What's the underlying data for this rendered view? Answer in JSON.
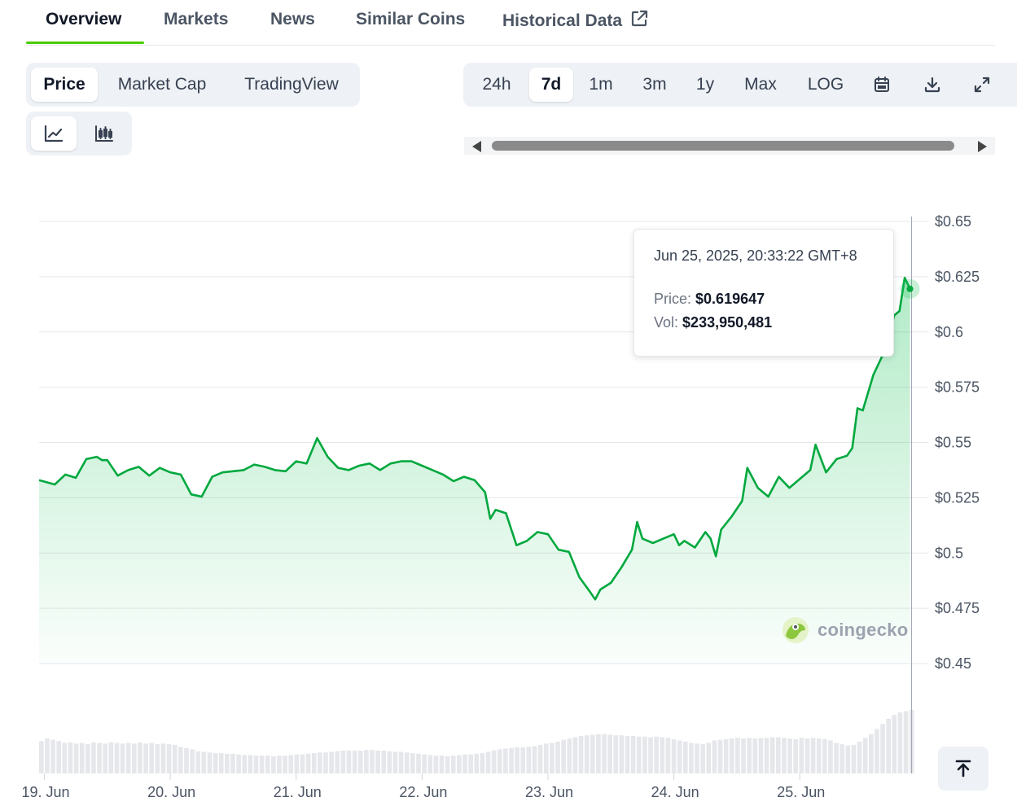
{
  "tabs": [
    {
      "label": "Overview",
      "active": true
    },
    {
      "label": "Markets",
      "active": false
    },
    {
      "label": "News",
      "active": false
    },
    {
      "label": "Similar Coins",
      "active": false
    },
    {
      "label": "Historical Data",
      "active": false,
      "icon": "external-link-icon"
    }
  ],
  "chart_type_options": [
    {
      "label": "Price",
      "active": true
    },
    {
      "label": "Market Cap",
      "active": false
    },
    {
      "label": "TradingView",
      "active": false
    }
  ],
  "chart_style_icons": [
    {
      "name": "line-chart-icon",
      "active": true
    },
    {
      "name": "candlestick-chart-icon",
      "active": false
    }
  ],
  "ranges": [
    {
      "label": "24h",
      "active": false
    },
    {
      "label": "7d",
      "active": true
    },
    {
      "label": "1m",
      "active": false
    },
    {
      "label": "3m",
      "active": false
    },
    {
      "label": "1y",
      "active": false
    },
    {
      "label": "Max",
      "active": false
    },
    {
      "label": "LOG",
      "active": false
    }
  ],
  "range_tool_icons": [
    "calendar-icon",
    "download-icon",
    "fullscreen-icon"
  ],
  "tooltip": {
    "date": "Jun 25, 2025, 20:33:22 GMT+8",
    "price_label": "Price:",
    "price_value": "$0.619647",
    "vol_label": "Vol:",
    "vol_value": "$233,950,481"
  },
  "watermark": "coingecko",
  "colors": {
    "line": "#00a83e",
    "accent": "#4bcc00",
    "fill": "#22c55e"
  },
  "chart_data": {
    "type": "area",
    "ylim": [
      0.43,
      0.65
    ],
    "yticks": [
      "$0.65",
      "$0.625",
      "$0.6",
      "$0.575",
      "$0.55",
      "$0.525",
      "$0.5",
      "$0.475",
      "$0.45"
    ],
    "ytick_values": [
      0.65,
      0.625,
      0.6,
      0.575,
      0.55,
      0.525,
      0.5,
      0.475,
      0.45
    ],
    "xlim": [
      "2025-06-18T23:00",
      "2025-06-25T22:00"
    ],
    "xticks": [
      "19. Jun",
      "20. Jun",
      "21. Jun",
      "22. Jun",
      "23. Jun",
      "24. Jun",
      "25. Jun"
    ],
    "xtick_values": [
      "2025-06-19T00:00",
      "2025-06-20T00:00",
      "2025-06-21T00:00",
      "2025-06-22T00:00",
      "2025-06-23T00:00",
      "2025-06-24T00:00",
      "2025-06-25T00:00"
    ],
    "series": [
      {
        "price": [
          [
            "2025-06-18T23:00",
            0.533
          ],
          [
            "2025-06-19T02:00",
            0.531
          ],
          [
            "2025-06-19T04:00",
            0.5355
          ],
          [
            "2025-06-19T06:00",
            0.534
          ],
          [
            "2025-06-19T08:00",
            0.5425
          ],
          [
            "2025-06-19T10:00",
            0.5435
          ],
          [
            "2025-06-19T11:00",
            0.542
          ],
          [
            "2025-06-19T12:00",
            0.542
          ],
          [
            "2025-06-19T14:00",
            0.535
          ],
          [
            "2025-06-19T16:00",
            0.5375
          ],
          [
            "2025-06-19T18:00",
            0.539
          ],
          [
            "2025-06-19T20:00",
            0.535
          ],
          [
            "2025-06-19T22:00",
            0.5385
          ],
          [
            "2025-06-20T00:00",
            0.5365
          ],
          [
            "2025-06-20T02:00",
            0.5355
          ],
          [
            "2025-06-20T04:00",
            0.5265
          ],
          [
            "2025-06-20T06:00",
            0.5255
          ],
          [
            "2025-06-20T08:00",
            0.5345
          ],
          [
            "2025-06-20T10:00",
            0.5365
          ],
          [
            "2025-06-20T12:00",
            0.537
          ],
          [
            "2025-06-20T14:00",
            0.5375
          ],
          [
            "2025-06-20T16:00",
            0.54
          ],
          [
            "2025-06-20T18:00",
            0.539
          ],
          [
            "2025-06-20T20:00",
            0.5375
          ],
          [
            "2025-06-20T22:00",
            0.537
          ],
          [
            "2025-06-21T00:00",
            0.5415
          ],
          [
            "2025-06-21T02:00",
            0.5405
          ],
          [
            "2025-06-21T04:00",
            0.552
          ],
          [
            "2025-06-21T06:00",
            0.5435
          ],
          [
            "2025-06-21T08:00",
            0.5385
          ],
          [
            "2025-06-21T10:00",
            0.5375
          ],
          [
            "2025-06-21T12:00",
            0.5395
          ],
          [
            "2025-06-21T14:00",
            0.5405
          ],
          [
            "2025-06-21T16:00",
            0.5375
          ],
          [
            "2025-06-21T18:00",
            0.5405
          ],
          [
            "2025-06-21T20:00",
            0.5415
          ],
          [
            "2025-06-21T22:00",
            0.5415
          ],
          [
            "2025-06-22T00:00",
            0.5395
          ],
          [
            "2025-06-22T02:00",
            0.5375
          ],
          [
            "2025-06-22T04:00",
            0.5355
          ],
          [
            "2025-06-22T06:00",
            0.5325
          ],
          [
            "2025-06-22T08:00",
            0.5345
          ],
          [
            "2025-06-22T10:00",
            0.533
          ],
          [
            "2025-06-22T12:00",
            0.5275
          ],
          [
            "2025-06-22T13:00",
            0.5155
          ],
          [
            "2025-06-22T14:00",
            0.5195
          ],
          [
            "2025-06-22T16:00",
            0.518
          ],
          [
            "2025-06-22T18:00",
            0.5035
          ],
          [
            "2025-06-22T20:00",
            0.5055
          ],
          [
            "2025-06-22T22:00",
            0.5095
          ],
          [
            "2025-06-23T00:00",
            0.5085
          ],
          [
            "2025-06-23T02:00",
            0.5015
          ],
          [
            "2025-06-23T04:00",
            0.5005
          ],
          [
            "2025-06-23T06:00",
            0.489
          ],
          [
            "2025-06-23T08:00",
            0.4825
          ],
          [
            "2025-06-23T09:00",
            0.479
          ],
          [
            "2025-06-23T10:00",
            0.4835
          ],
          [
            "2025-06-23T12:00",
            0.4865
          ],
          [
            "2025-06-23T14:00",
            0.4935
          ],
          [
            "2025-06-23T16:00",
            0.5015
          ],
          [
            "2025-06-23T17:00",
            0.514
          ],
          [
            "2025-06-23T18:00",
            0.5065
          ],
          [
            "2025-06-23T20:00",
            0.5045
          ],
          [
            "2025-06-23T22:00",
            0.5065
          ],
          [
            "2025-06-24T00:00",
            0.5085
          ],
          [
            "2025-06-24T01:00",
            0.5035
          ],
          [
            "2025-06-24T02:00",
            0.5055
          ],
          [
            "2025-06-24T04:00",
            0.5025
          ],
          [
            "2025-06-24T06:00",
            0.5095
          ],
          [
            "2025-06-24T07:00",
            0.5065
          ],
          [
            "2025-06-24T08:00",
            0.4985
          ],
          [
            "2025-06-24T09:00",
            0.5105
          ],
          [
            "2025-06-24T11:00",
            0.5165
          ],
          [
            "2025-06-24T13:00",
            0.5235
          ],
          [
            "2025-06-24T14:00",
            0.5385
          ],
          [
            "2025-06-24T16:00",
            0.5295
          ],
          [
            "2025-06-24T18:00",
            0.5255
          ],
          [
            "2025-06-24T20:00",
            0.5345
          ],
          [
            "2025-06-24T22:00",
            0.5295
          ],
          [
            "2025-06-25T00:00",
            0.5335
          ],
          [
            "2025-06-25T02:00",
            0.5375
          ],
          [
            "2025-06-25T03:00",
            0.549
          ],
          [
            "2025-06-25T05:00",
            0.5365
          ],
          [
            "2025-06-25T07:00",
            0.5425
          ],
          [
            "2025-06-25T09:00",
            0.544
          ],
          [
            "2025-06-25T10:00",
            0.5475
          ],
          [
            "2025-06-25T11:00",
            0.5655
          ],
          [
            "2025-06-25T12:00",
            0.5645
          ],
          [
            "2025-06-25T14:00",
            0.5805
          ],
          [
            "2025-06-25T16:00",
            0.5905
          ],
          [
            "2025-06-25T18:00",
            0.6075
          ],
          [
            "2025-06-25T19:00",
            0.6095
          ],
          [
            "2025-06-25T20:00",
            0.6245
          ],
          [
            "2025-06-25T21:00",
            0.6195
          ]
        ]
      }
    ],
    "volume_relative": [
      0.51,
      0.55,
      0.53,
      0.51,
      0.48,
      0.49,
      0.47,
      0.48,
      0.46,
      0.49,
      0.48,
      0.47,
      0.49,
      0.48,
      0.47,
      0.48,
      0.47,
      0.49,
      0.47,
      0.48,
      0.46,
      0.47,
      0.46,
      0.45,
      0.42,
      0.4,
      0.38,
      0.35,
      0.34,
      0.33,
      0.32,
      0.32,
      0.31,
      0.31,
      0.3,
      0.29,
      0.29,
      0.28,
      0.28,
      0.28,
      0.27,
      0.28,
      0.28,
      0.29,
      0.3,
      0.3,
      0.31,
      0.32,
      0.33,
      0.33,
      0.34,
      0.35,
      0.36,
      0.36,
      0.36,
      0.36,
      0.37,
      0.37,
      0.36,
      0.36,
      0.35,
      0.34,
      0.34,
      0.33,
      0.32,
      0.31,
      0.3,
      0.29,
      0.28,
      0.28,
      0.27,
      0.28,
      0.29,
      0.3,
      0.3,
      0.31,
      0.32,
      0.34,
      0.36,
      0.38,
      0.39,
      0.4,
      0.41,
      0.41,
      0.42,
      0.43,
      0.45,
      0.47,
      0.48,
      0.5,
      0.53,
      0.55,
      0.57,
      0.59,
      0.6,
      0.61,
      0.62,
      0.62,
      0.61,
      0.6,
      0.6,
      0.59,
      0.59,
      0.58,
      0.58,
      0.57,
      0.58,
      0.57,
      0.56,
      0.54,
      0.52,
      0.5,
      0.48,
      0.47,
      0.46,
      0.48,
      0.52,
      0.53,
      0.54,
      0.55,
      0.56,
      0.55,
      0.56,
      0.55,
      0.56,
      0.56,
      0.57,
      0.57,
      0.56,
      0.55,
      0.54,
      0.56,
      0.55,
      0.56,
      0.55,
      0.54,
      0.52,
      0.48,
      0.46,
      0.44,
      0.45,
      0.5,
      0.56,
      0.62,
      0.7,
      0.78,
      0.86,
      0.92,
      0.96,
      0.98,
      1.0
    ]
  }
}
